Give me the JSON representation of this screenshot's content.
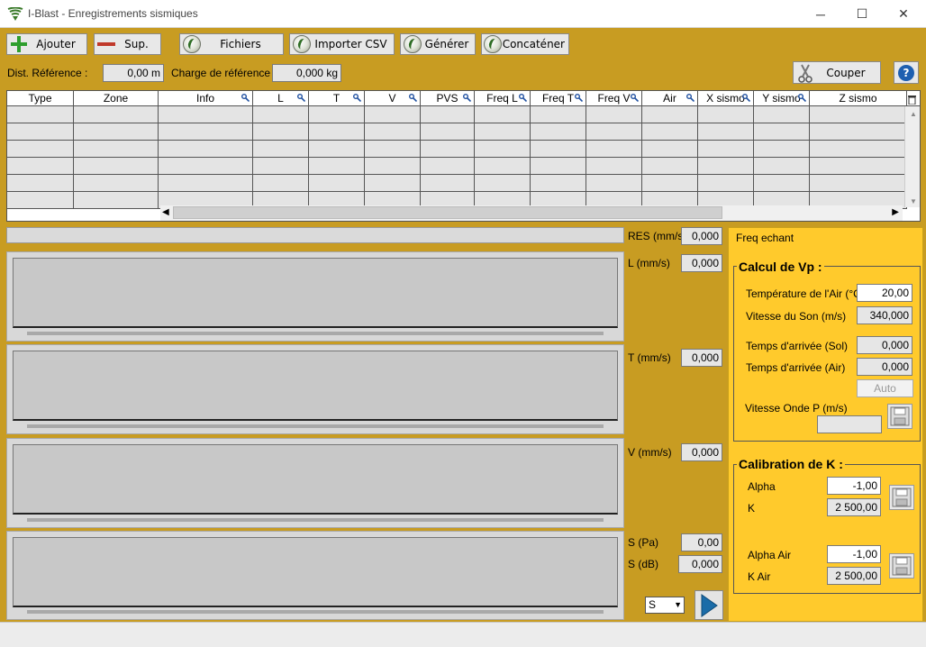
{
  "window": {
    "title": "I-Blast - Enregistrements sismiques",
    "minimize_label": "─",
    "maximize_label": "☐",
    "close_label": "✕"
  },
  "toolbar": {
    "add_label": "Ajouter",
    "delete_label": "Sup.",
    "files_label": "Fichiers",
    "import_label": "Importer CSV",
    "generate_label": "Générer",
    "concat_label": "Concaténer",
    "cut_label": "Couper",
    "help_label": "?"
  },
  "reference": {
    "dist_label": "Dist. Référence :",
    "dist_value": "0,00 m",
    "charge_label": "Charge de référence :",
    "charge_value": "0,000 kg"
  },
  "table": {
    "columns": [
      "Type",
      "Zone",
      "Info",
      "L",
      "T",
      "V",
      "PVS",
      "Freq L",
      "Freq T",
      "Freq V",
      "Air",
      "X sismo",
      "Y sismo",
      "Z sismo"
    ],
    "row_count": 6
  },
  "measures": {
    "res_label": "RES (mm/s)",
    "res_value": "0,000",
    "l_label": "L (mm/s)",
    "l_value": "0,000",
    "t_label": "T (mm/s)",
    "t_value": "0,000",
    "v_label": "V (mm/s)",
    "v_value": "0,000",
    "s_pa_label": "S (Pa)",
    "s_pa_value": "0,00",
    "s_db_label": "S (dB)",
    "s_db_value": "0,000",
    "unit_select": "S"
  },
  "right_panel": {
    "freq_label": "Freq echant",
    "vp_title": "Calcul de Vp :",
    "air_temp_label": "Température de l'Air (°C)",
    "air_temp_value": "20,00",
    "sound_speed_label": "Vitesse du Son (m/s)",
    "sound_speed_value": "340,000",
    "arrival_ground_label": "Temps d'arrivée (Sol)",
    "arrival_ground_value": "0,000",
    "arrival_air_label": "Temps d'arrivée (Air)",
    "arrival_air_value": "0,000",
    "auto_label": "Auto",
    "p_wave_label": "Vitesse Onde P (m/s)",
    "p_wave_value": "",
    "k_title": "Calibration de K :",
    "alpha_label": "Alpha",
    "alpha_value": "-1,00",
    "k_label": "K",
    "k_value": "2 500,00",
    "alpha_air_label": "Alpha Air",
    "alpha_air_value": "-1,00",
    "k_air_label": "K Air",
    "k_air_value": "2 500,00"
  },
  "colors": {
    "background": "#C89C22",
    "right_panel": "#FFCA2C",
    "add_icon": "#2E9E2E",
    "delete_icon": "#C0392B"
  }
}
